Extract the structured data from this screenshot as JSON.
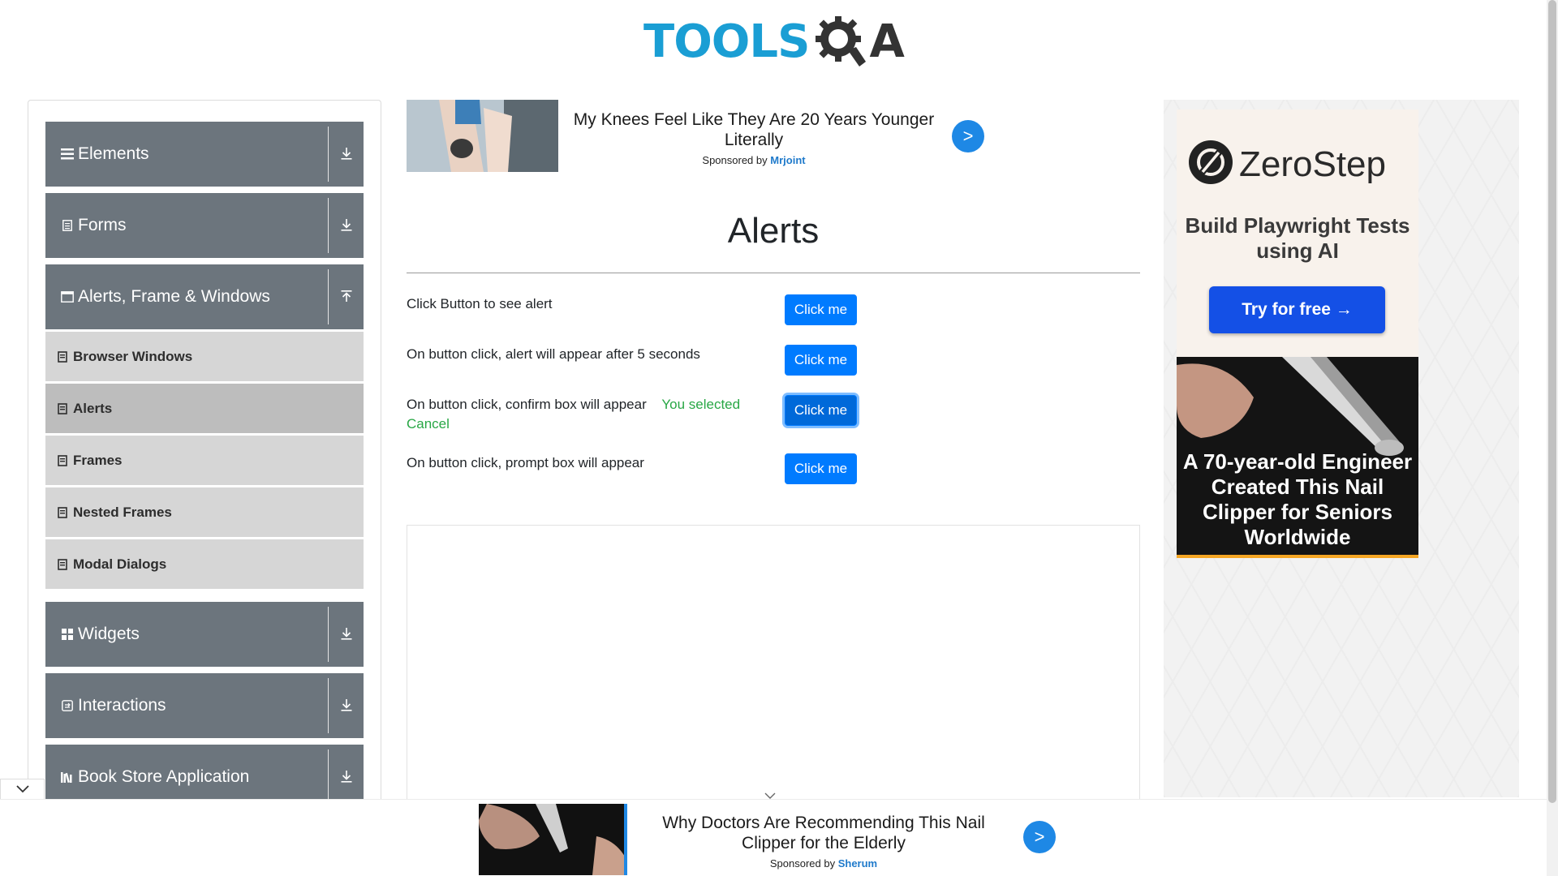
{
  "header": {
    "logo_text": "TOOLS",
    "logo_suffix": "A"
  },
  "sidebar": {
    "groups": [
      {
        "label": "Elements"
      },
      {
        "label": "Forms"
      },
      {
        "label": "Alerts, Frame & Windows"
      },
      {
        "label": "Widgets"
      },
      {
        "label": "Interactions"
      },
      {
        "label": "Book Store Application"
      }
    ],
    "items": [
      {
        "label": "Browser Windows"
      },
      {
        "label": "Alerts"
      },
      {
        "label": "Frames"
      },
      {
        "label": "Nested Frames"
      },
      {
        "label": "Modal Dialogs"
      }
    ]
  },
  "top_ad": {
    "title": "My Knees Feel Like They Are 20 Years Younger Literally",
    "sponsored_by": "Sponsored by",
    "sponsor": "Mrjoint",
    "go": ">"
  },
  "main": {
    "title": "Alerts",
    "rows": [
      {
        "text": "Click Button to see alert",
        "button": "Click me"
      },
      {
        "text": "On button click, alert will appear after 5 seconds",
        "button": "Click me"
      },
      {
        "text": "On button click, confirm box will appear",
        "result_prefix": "You selected",
        "result_value": "Cancel",
        "button": "Click me"
      },
      {
        "text": "On button click, prompt box will appear",
        "button": "Click me"
      }
    ]
  },
  "right_ad": {
    "brand": "ZeroStep",
    "tagline": "Build Playwright Tests using AI",
    "cta": "Try for free →",
    "nail_text": "A 70-year-old Engineer Created This Nail Clipper for Seniors Worldwide"
  },
  "bottom_ad": {
    "title": "Why Doctors Are Recommending This Nail Clipper for the Elderly",
    "sponsored_by": "Sponsored by",
    "sponsor": "Sherum",
    "go": ">"
  },
  "colors": {
    "logo_blue": "#1a9ed4",
    "sidebar_group": "#6c757d",
    "sidebar_item": "#d6d6d6",
    "button_primary": "#007bff",
    "result_green": "#28a745",
    "cta_blue": "#1450e6"
  }
}
